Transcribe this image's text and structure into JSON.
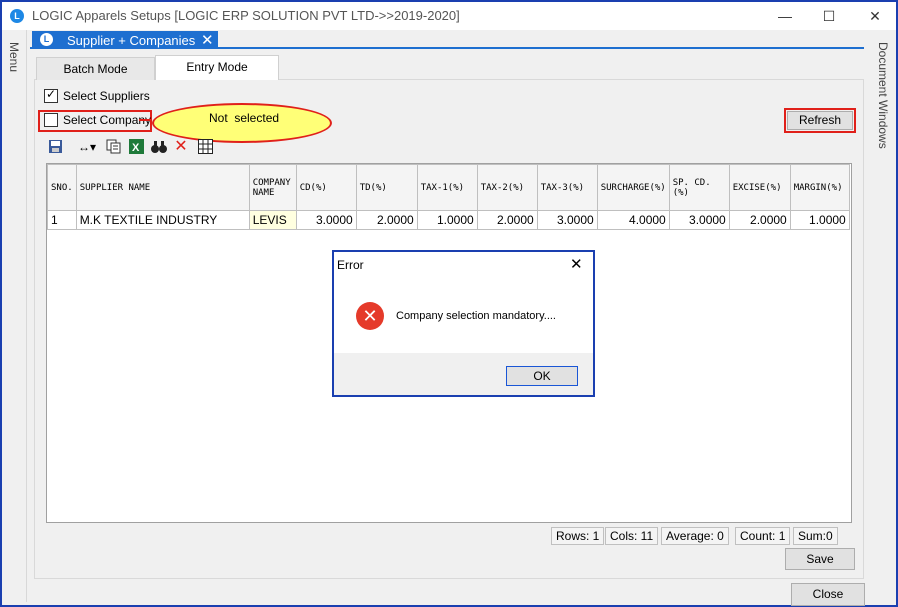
{
  "window": {
    "title": "LOGIC Apparels Setups  [LOGIC ERP SOLUTION PVT LTD->>2019-2020]",
    "app_icon": "L",
    "minimize": "—",
    "maximize": "☐",
    "close": "✕"
  },
  "sidebars": {
    "left_label": "Menu",
    "right_label": "Document Windows"
  },
  "doc_tab": {
    "label": "Supplier + Companies",
    "close": "✕"
  },
  "mode_tabs": [
    {
      "label": "Batch Mode"
    },
    {
      "label": "Entry Mode"
    }
  ],
  "filters": {
    "select_suppliers": {
      "label": "Select Suppliers",
      "checked": true
    },
    "select_company": {
      "label": "Select Company",
      "checked": false
    },
    "callout": "Not  selected",
    "refresh_label": "Refresh"
  },
  "toolbar": {
    "icons": [
      "save-icon",
      "column-width-icon",
      "copy-icon",
      "excel-icon",
      "find-icon",
      "delete-icon",
      "grid-icon"
    ],
    "colors": {
      "excel": "#1f7a3a",
      "delete": "#e0201a"
    }
  },
  "grid": {
    "headers": [
      "SNO.",
      "SUPPLIER NAME",
      "COMPANY NAME",
      "CD(%)",
      "TD(%)",
      "TAX-1(%)",
      "TAX-2(%)",
      "TAX-3(%)",
      "SURCHARGE(%)",
      "SP. CD.(%)",
      "EXCISE(%)",
      "MARGIN(%)"
    ],
    "rows": [
      [
        "1",
        "M.K TEXTILE INDUSTRY",
        "LEVIS",
        "3.0000",
        "2.0000",
        "1.0000",
        "2.0000",
        "3.0000",
        "4.0000",
        "3.0000",
        "2.0000",
        "1.0000"
      ]
    ]
  },
  "status": {
    "rows": "Rows: 1",
    "cols": "Cols: 11",
    "average": "Average: 0",
    "count": "Count: 1",
    "sum": "Sum:0"
  },
  "buttons": {
    "save": "Save",
    "close": "Close"
  },
  "dialog": {
    "title": "Error",
    "close": "✕",
    "message": "Company selection mandatory....",
    "ok": "OK",
    "icon": "error-icon"
  },
  "colors": {
    "accent": "#1e6fd0",
    "highlight_red": "#e0201a",
    "callout_yellow": "#ffff77"
  }
}
